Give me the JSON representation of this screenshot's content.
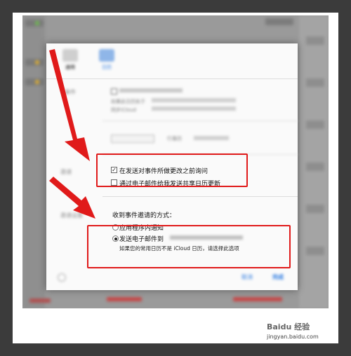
{
  "dialog": {
    "sections": {
      "blurred_top_labels": [
        "通用",
        "日历"
      ],
      "blurred_row_text": [
        "如果此日历处于",
        "将在发送邀请时",
        "同步iCloud"
      ],
      "blurred_right_label": "行事历",
      "blurred_side_labels": [
        "事件",
        "邀请",
        "邀请设置"
      ]
    },
    "ask_before_send": "在发送对事件所做更改之前询问",
    "email_share_update": "通过电子邮件给我发送共享日历更新",
    "invitation_heading": "收到事件邀请的方式：",
    "option_in_app": "应用程序内通知",
    "option_email": "发送电子邮件到",
    "option_email_hint": "如果您的常用日历不是 iCloud 日历，请选择此选项",
    "btn_cancel": "取消",
    "btn_done": "完成"
  },
  "footer": {
    "watermark": "jingyan.baidu.com",
    "baidu_label": "Baidu 经验"
  },
  "colors": {
    "annotation_red": "#e01a1a",
    "accent_blue": "#2a7ae2"
  }
}
